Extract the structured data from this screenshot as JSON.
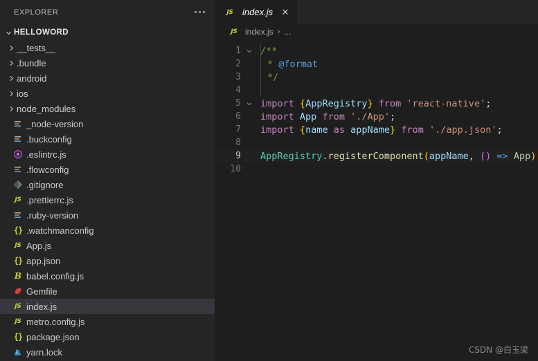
{
  "sidebar": {
    "title": "EXPLORER",
    "more_label": "…",
    "root": {
      "label": "HELLOWORD",
      "expanded": true
    },
    "items": [
      {
        "label": "__tests__",
        "kind": "folder",
        "icon": "chevron-right-icon"
      },
      {
        "label": ".bundle",
        "kind": "folder",
        "icon": "chevron-right-icon"
      },
      {
        "label": "android",
        "kind": "folder",
        "icon": "chevron-right-icon"
      },
      {
        "label": "ios",
        "kind": "folder",
        "icon": "chevron-right-icon"
      },
      {
        "label": "node_modules",
        "kind": "folder",
        "icon": "chevron-right-icon"
      },
      {
        "label": "_node-version",
        "kind": "file",
        "icon": "config-file-icon"
      },
      {
        "label": ".buckconfig",
        "kind": "file",
        "icon": "config-file-icon"
      },
      {
        "label": ".eslintrc.js",
        "kind": "file",
        "icon": "eslint-icon"
      },
      {
        "label": ".flowconfig",
        "kind": "file",
        "icon": "config-file-icon"
      },
      {
        "label": ".gitignore",
        "kind": "file",
        "icon": "git-icon"
      },
      {
        "label": ".prettierrc.js",
        "kind": "file",
        "icon": "js-icon"
      },
      {
        "label": ".ruby-version",
        "kind": "file",
        "icon": "config-file-icon"
      },
      {
        "label": ".watchmanconfig",
        "kind": "file",
        "icon": "json-icon"
      },
      {
        "label": "App.js",
        "kind": "file",
        "icon": "js-icon"
      },
      {
        "label": "app.json",
        "kind": "file",
        "icon": "json-icon"
      },
      {
        "label": "babel.config.js",
        "kind": "file",
        "icon": "babel-icon"
      },
      {
        "label": "Gemfile",
        "kind": "file",
        "icon": "ruby-icon"
      },
      {
        "label": "index.js",
        "kind": "file",
        "icon": "js-icon",
        "selected": true
      },
      {
        "label": "metro.config.js",
        "kind": "file",
        "icon": "js-icon"
      },
      {
        "label": "package.json",
        "kind": "file",
        "icon": "json-icon"
      },
      {
        "label": "yarn.lock",
        "kind": "file",
        "icon": "yarn-icon"
      }
    ]
  },
  "editor": {
    "tab": {
      "label": "index.js",
      "icon": "js-icon",
      "close_label": "✕",
      "preview": true
    },
    "breadcrumb": {
      "file": "index.js",
      "separator": "›",
      "overflow": "..."
    },
    "active_line": 9,
    "lines": [
      {
        "n": "1",
        "fold": "chevron-down-icon"
      },
      {
        "n": "2",
        "fold": ""
      },
      {
        "n": "3",
        "fold": ""
      },
      {
        "n": "4",
        "fold": ""
      },
      {
        "n": "5",
        "fold": "chevron-down-icon"
      },
      {
        "n": "6",
        "fold": ""
      },
      {
        "n": "7",
        "fold": ""
      },
      {
        "n": "8",
        "fold": ""
      },
      {
        "n": "9",
        "fold": ""
      },
      {
        "n": "10",
        "fold": ""
      }
    ],
    "code": {
      "l1": "/**",
      "l2a": "* ",
      "l2b": "@format",
      "l3": "*/",
      "l5a": "import",
      "l5b": "{",
      "l5c": "AppRegistry",
      "l5d": "}",
      "l5e": "from",
      "l5f": "'react-native'",
      "l5g": ";",
      "l6a": "import",
      "l6b": "App",
      "l6c": "from",
      "l6d": "'./App'",
      "l6e": ";",
      "l7a": "import",
      "l7b": "{",
      "l7c": "name",
      "l7d": "as",
      "l7e": "appName",
      "l7f": "}",
      "l7g": "from",
      "l7h": "'./app.json'",
      "l7i": ";",
      "l9a": "AppRegistry",
      "l9b": ".",
      "l9c": "registerComponent",
      "l9d": "(",
      "l9e": "appName",
      "l9f": ", ",
      "l9g": "()",
      "l9h": " => ",
      "l9i": "App",
      "l9j": ")",
      "l9k": ";"
    }
  },
  "watermark": "CSDN @白玉梁"
}
